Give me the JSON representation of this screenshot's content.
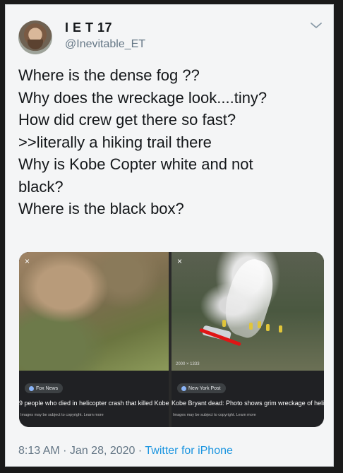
{
  "user": {
    "display_name": "I E T 17",
    "handle": "@Inevitable_ET"
  },
  "tweet": {
    "lines": [
      "Where is the dense fog ??",
      "Why does the wreckage look....tiny?",
      "How did crew get there so fast?",
      ">>literally a hiking trail there",
      "Why is Kobe Copter white and not",
      "black?",
      "Where is the black box?"
    ]
  },
  "media": {
    "left": {
      "source": "Fox News",
      "caption": "9 people who died in helicopter crash that killed Kobe",
      "notice": "Images may be subject to copyright. Learn more",
      "close": "×"
    },
    "right": {
      "dims": "2000 × 1333",
      "source": "New York Post",
      "caption": "Kobe Bryant dead: Photo shows grim wreckage of helicopter",
      "notice": "Images may be subject to copyright. Learn more",
      "close": "×"
    }
  },
  "footer": {
    "time": "8:13 AM",
    "sep1": " · ",
    "date": "Jan 28, 2020",
    "sep2": " · ",
    "via": "Twitter for iPhone"
  },
  "icons": {
    "chevron": "chevron-down-icon",
    "avatar": "avatar"
  },
  "colors": {
    "link": "#1b95e0",
    "text": "#14171a",
    "secondary": "#657786",
    "highlight_red": "#e01515"
  }
}
